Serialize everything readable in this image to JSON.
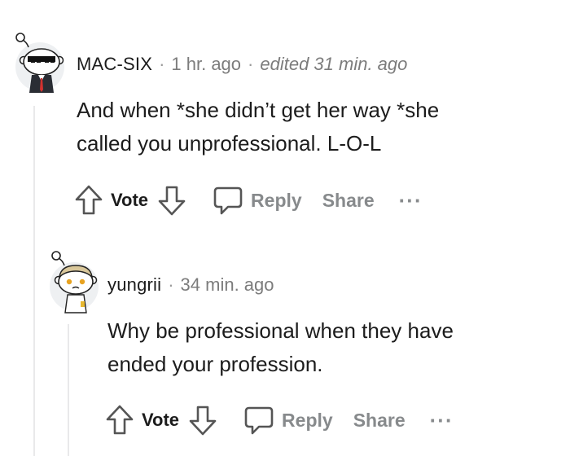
{
  "comments": [
    {
      "username": "MAC-SIX",
      "time": "1 hr. ago",
      "edited": "edited 31 min. ago",
      "body": [
        "And when *she didn’t get her way *she",
        "called you unprofessional. L-O-L"
      ],
      "actions": {
        "vote": "Vote",
        "reply": "Reply",
        "share": "Share",
        "more": "···"
      }
    },
    {
      "username": "yungrii",
      "time": "34 min. ago",
      "body": [
        "Why be professional when they have",
        "ended your profession."
      ],
      "actions": {
        "vote": "Vote",
        "reply": "Reply",
        "share": "Share",
        "more": "···"
      }
    }
  ],
  "colors": {
    "meta": "#7c7c7c",
    "action": "#878a8c",
    "thread": "#e9e9ea"
  },
  "icons": [
    "upvote-icon",
    "downvote-icon",
    "reply-icon",
    "more-icon"
  ]
}
